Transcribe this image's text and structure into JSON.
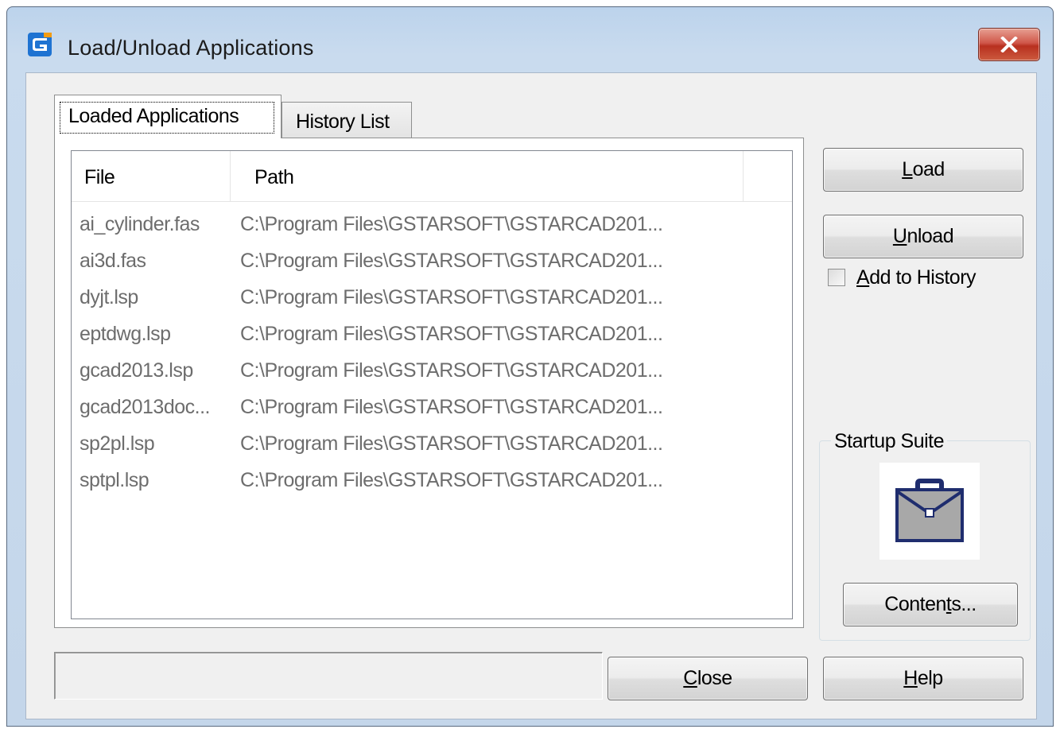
{
  "window": {
    "title": "Load/Unload Applications",
    "close_icon": "close-x-icon",
    "app_icon": "gstarcad-logo-icon"
  },
  "tabs": [
    {
      "label": "Loaded Applications",
      "active": true
    },
    {
      "label": "History List",
      "active": false
    }
  ],
  "list": {
    "columns": [
      "File",
      "Path"
    ],
    "rows": [
      {
        "file": "ai_cylinder.fas",
        "path": "C:\\Program Files\\GSTARSOFT\\GSTARCAD201..."
      },
      {
        "file": "ai3d.fas",
        "path": "C:\\Program Files\\GSTARSOFT\\GSTARCAD201..."
      },
      {
        "file": "dyjt.lsp",
        "path": "C:\\Program Files\\GSTARSOFT\\GSTARCAD201..."
      },
      {
        "file": "eptdwg.lsp",
        "path": "C:\\Program Files\\GSTARSOFT\\GSTARCAD201..."
      },
      {
        "file": "gcad2013.lsp",
        "path": "C:\\Program Files\\GSTARSOFT\\GSTARCAD201..."
      },
      {
        "file": "gcad2013doc...",
        "path": "C:\\Program Files\\GSTARSOFT\\GSTARCAD201..."
      },
      {
        "file": "sp2pl.lsp",
        "path": "C:\\Program Files\\GSTARSOFT\\GSTARCAD201..."
      },
      {
        "file": "sptpl.lsp",
        "path": "C:\\Program Files\\GSTARSOFT\\GSTARCAD201..."
      }
    ]
  },
  "buttons": {
    "load": {
      "first": "L",
      "rest": "oad"
    },
    "unload": {
      "first": "U",
      "rest": "nload"
    },
    "contents": {
      "pre": "Conten",
      "mnemonic": "t",
      "post": "s..."
    },
    "close": {
      "first": "C",
      "rest": "lose"
    },
    "help": {
      "first": "H",
      "rest": "elp"
    }
  },
  "add_to_history": {
    "first": "A",
    "rest": "dd to History",
    "checked": false
  },
  "startup_suite": {
    "label": "Startup Suite",
    "icon": "briefcase-icon"
  },
  "status": {
    "text": ""
  },
  "colors": {
    "accent_gstar": "#1e73d2",
    "close_red": "#c0392b",
    "icon_navy": "#1f2d6e"
  }
}
